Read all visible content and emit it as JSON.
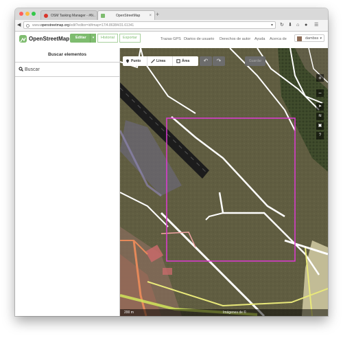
{
  "browser": {
    "tabs": [
      {
        "title": "OSM Tasking Manager - #6...",
        "close": "×"
      },
      {
        "title": "OpenStreetMap",
        "close": "×"
      }
    ],
    "new_tab": "+",
    "url_prefix": "www.",
    "url_domain": "openstreetmap.org",
    "url_path": "/edit?editor=id#map=17/4.86384/31.61341"
  },
  "header": {
    "brand": "OpenStreetMap",
    "edit_label": "Editar",
    "history_label": "Historial",
    "export_label": "Exportar",
    "nav": [
      "Trazas GPS",
      "Diarios de usuario",
      "Derechos de autor",
      "Ayuda",
      "Acerca de"
    ],
    "user": "dambss",
    "colors": {
      "brand_green": "#7ebc6f"
    }
  },
  "sidebar": {
    "title": "Buscar elementos",
    "search_placeholder": "Buscar"
  },
  "map": {
    "tools": {
      "point": "Punto",
      "line": "Línea",
      "area": "Área"
    },
    "undo_icon": "undo-icon",
    "redo_icon": "redo-icon",
    "save_label": "Guardar",
    "zoom_in": "+",
    "zoom_out": "−",
    "scale": "200 m",
    "attribution": "Imágenes de ©"
  }
}
